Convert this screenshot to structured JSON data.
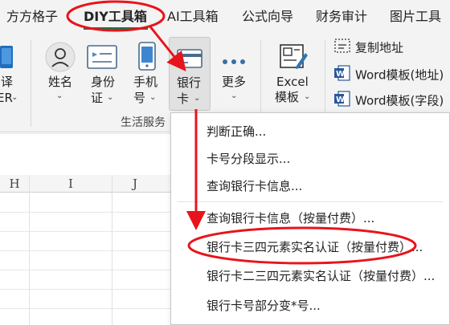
{
  "tabs": [
    {
      "label": "方方格子",
      "active": false
    },
    {
      "label": "DIY工具箱",
      "active": true
    },
    {
      "label": "AI工具箱",
      "active": false
    },
    {
      "label": "公式向导",
      "active": false
    },
    {
      "label": "财务审计",
      "active": false
    },
    {
      "label": "图片工具",
      "active": false
    }
  ],
  "ribbon": {
    "translate": {
      "line1": "翻译",
      "line2": "ER"
    },
    "name": {
      "line1": "姓名"
    },
    "idcard": {
      "line1": "身份",
      "line2": "证"
    },
    "phone": {
      "line1": "手机",
      "line2": "号"
    },
    "bankcard": {
      "line1": "银行",
      "line2": "卡"
    },
    "more": {
      "line1": "更多"
    },
    "excel_template": {
      "line1": "Excel",
      "line2": "模板"
    },
    "group_label": "生活服务",
    "small_items": {
      "copy_address": "复制地址",
      "word_template_address": "Word模板(地址)",
      "word_template_field": "Word模板(字段)"
    },
    "accent_color": "#1e7145"
  },
  "grid": {
    "columns": [
      "H",
      "I",
      "J"
    ]
  },
  "menu": {
    "items": [
      "判断正确...",
      "卡号分段显示...",
      "查询银行卡信息...",
      "查询银行卡信息（按量付费）...",
      "银行卡三四元素实名认证（按量付费）...",
      "银行卡二三四元素实名认证（按量付费）...",
      "银行卡号部分变*号..."
    ]
  },
  "annotation_color": "#e8141b"
}
